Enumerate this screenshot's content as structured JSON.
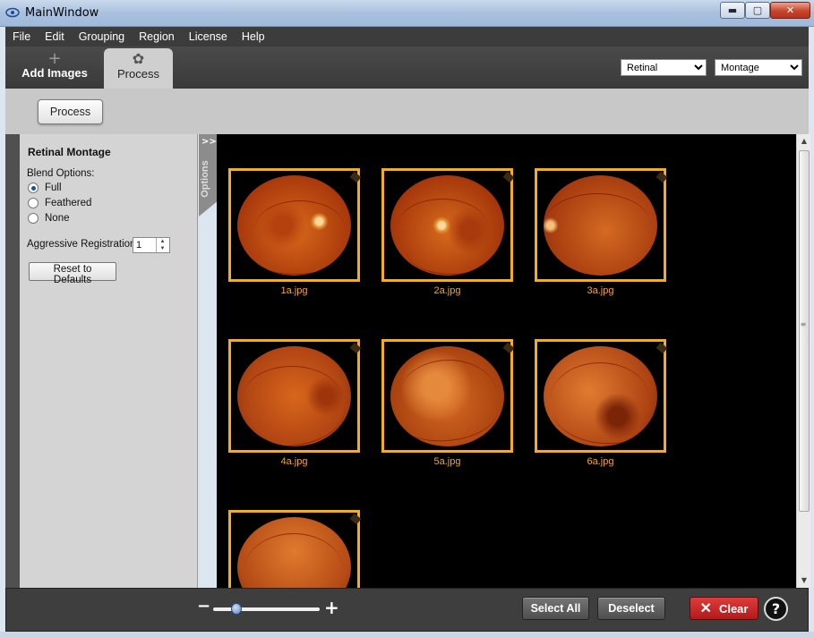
{
  "window": {
    "title": "MainWindow",
    "minimize_glyph": "▬",
    "maximize_glyph": "▢",
    "close_glyph": "✕"
  },
  "menu": {
    "items": [
      "File",
      "Edit",
      "Grouping",
      "Region",
      "License",
      "Help"
    ]
  },
  "tabs": {
    "add_images": {
      "label": "Add Images",
      "icon": "plus-icon",
      "glyph": "+"
    },
    "process": {
      "label": "Process",
      "icon": "flower-icon",
      "glyph": "✿"
    }
  },
  "dropdowns": {
    "domain": {
      "selected": "Retinal"
    },
    "mode": {
      "selected": "Montage"
    }
  },
  "toolbar": {
    "process_label": "Process"
  },
  "options": {
    "tab_label": "Options",
    "tab_chevron": ">>",
    "title": "Retinal Montage",
    "blend_label": "Blend Options:",
    "blend_options": [
      "Full",
      "Feathered",
      "None"
    ],
    "blend_selected": "Full",
    "aggressive_label": "Aggressive Registration:",
    "aggressive_value": "1",
    "reset_label": "Reset to Defaults"
  },
  "images": [
    {
      "name": "1a.jpg",
      "selected": true
    },
    {
      "name": "2a.jpg",
      "selected": true
    },
    {
      "name": "3a.jpg",
      "selected": true
    },
    {
      "name": "4a.jpg",
      "selected": true
    },
    {
      "name": "5a.jpg",
      "selected": true
    },
    {
      "name": "6a.jpg",
      "selected": true
    },
    {
      "name": "",
      "selected": true
    }
  ],
  "bottom": {
    "zoom_minus": "−",
    "zoom_plus": "+",
    "select_all_label": "Select All",
    "deselect_label": "Deselect",
    "clear_label": "Clear",
    "help_label": "?"
  },
  "colors": {
    "selection_border": "#f7ad1a",
    "label_text": "#f5a623",
    "clear_button": "#c62828"
  }
}
